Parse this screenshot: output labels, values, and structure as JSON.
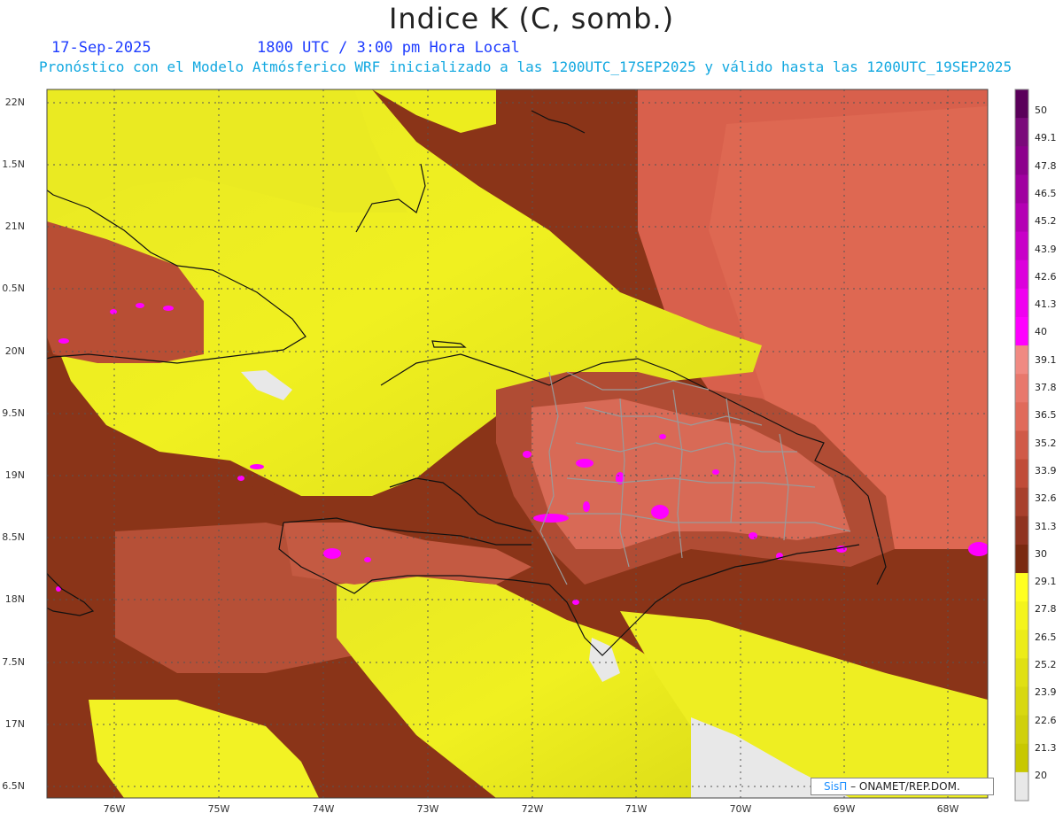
{
  "header": {
    "title": "Indice K (C, somb.)",
    "date": "17-Sep-2025",
    "utc": "1800 UTC / 3:00 pm Hora Local",
    "subtitle": "Pronóstico con el Modelo Atmósferico WRF inicializado a las 1200UTC_17SEP2025 y válido hasta las  1200UTC_19SEP2025"
  },
  "axes": {
    "lat_labels": [
      "22N",
      "1.5N",
      "21N",
      "0.5N",
      "20N",
      "9.5N",
      "19N",
      "8.5N",
      "18N",
      "7.5N",
      "17N",
      "6.5N"
    ],
    "lon_labels": [
      "76W",
      "75W",
      "74W",
      "73W",
      "72W",
      "71W",
      "70W",
      "69W",
      "68W"
    ]
  },
  "colorbar": {
    "labels": [
      "50",
      "49.1",
      "47.8",
      "46.5",
      "45.2",
      "43.9",
      "42.6",
      "41.3",
      "40",
      "39.1",
      "37.8",
      "36.5",
      "35.2",
      "33.9",
      "32.6",
      "31.3",
      "30",
      "29.1",
      "27.8",
      "26.5",
      "25.2",
      "23.9",
      "22.6",
      "21.3",
      "20"
    ],
    "colors": {
      "below_20": "#e8e8e8",
      "yellow_low": "#c8c800",
      "yellow_high": "#ffff20",
      "brown_dark": "#7a2a10",
      "salmon": "#f08070",
      "magenta": "#ff00ff",
      "purple": "#5a005a"
    }
  },
  "credit": {
    "brand": "SisΠ",
    "text": "– ONAMET/REP.DOM."
  }
}
